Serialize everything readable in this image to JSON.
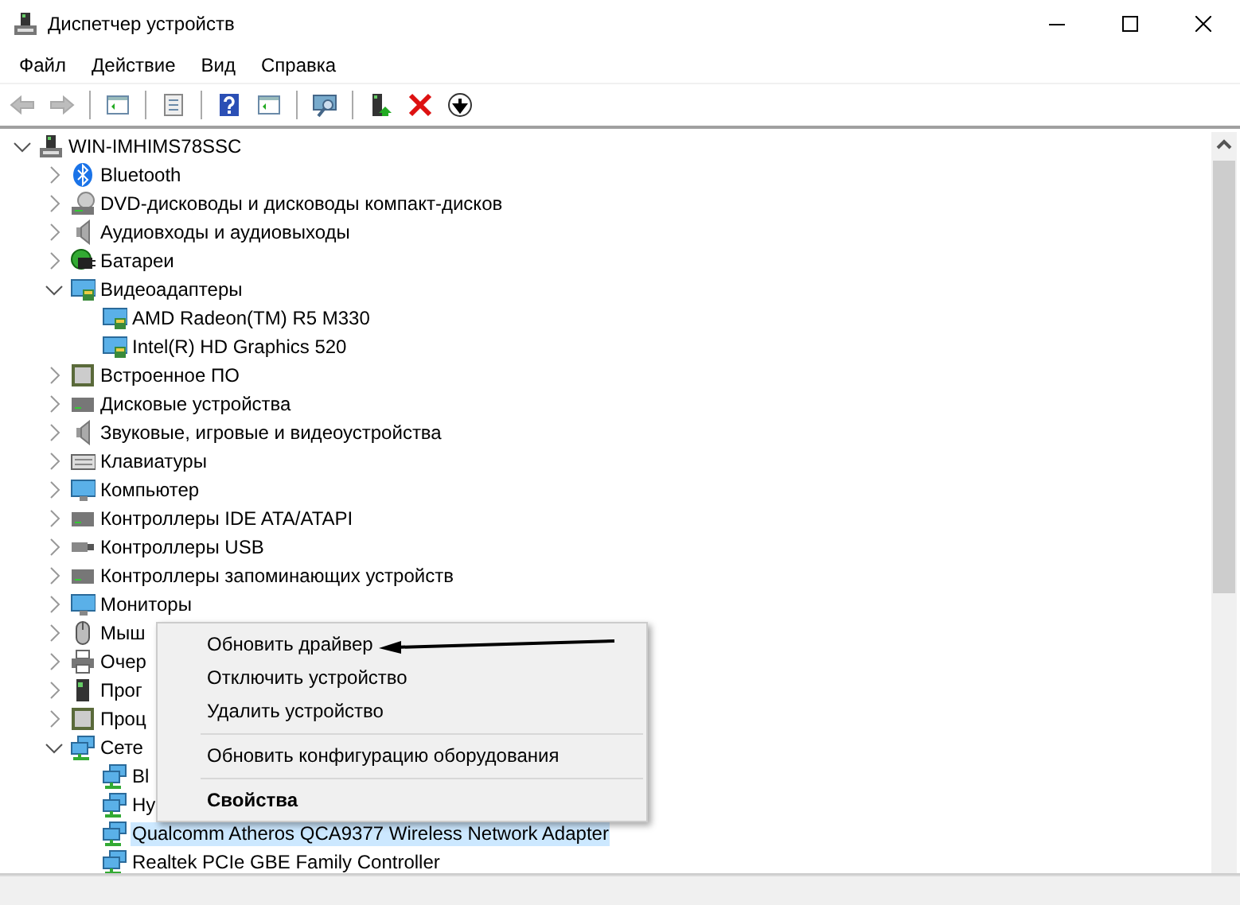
{
  "window": {
    "title": "Диспетчер устройств"
  },
  "menu_bar": [
    {
      "label": "Файл"
    },
    {
      "label": "Действие"
    },
    {
      "label": "Вид"
    },
    {
      "label": "Справка"
    }
  ],
  "toolbar": [
    {
      "kind": "back",
      "disabled": true
    },
    {
      "kind": "forward",
      "disabled": true
    },
    {
      "kind": "separator"
    },
    {
      "kind": "pane"
    },
    {
      "kind": "separator"
    },
    {
      "kind": "properties"
    },
    {
      "kind": "separator"
    },
    {
      "kind": "help"
    },
    {
      "kind": "pane"
    },
    {
      "kind": "separator"
    },
    {
      "kind": "scan"
    },
    {
      "kind": "separator"
    },
    {
      "kind": "update"
    },
    {
      "kind": "remove"
    },
    {
      "kind": "download"
    }
  ],
  "tree": [
    {
      "label": "WIN-IMHIMS78SSC",
      "kind": "computer",
      "expanded": true,
      "selected": false,
      "children": [
        {
          "label": "Bluetooth",
          "kind": "bluetooth",
          "expanded": false,
          "selected": false
        },
        {
          "label": "DVD-дисководы и дисководы компакт-дисков",
          "kind": "disc",
          "expanded": false,
          "selected": false
        },
        {
          "label": "Аудиовходы и аудиовыходы",
          "kind": "speaker",
          "expanded": false,
          "selected": false
        },
        {
          "label": "Батареи",
          "kind": "battery",
          "expanded": false,
          "selected": false
        },
        {
          "label": "Видеоадаптеры",
          "kind": "display",
          "expanded": true,
          "selected": false,
          "children": [
            {
              "label": "AMD Radeon(TM) R5 M330",
              "kind": "display",
              "selected": false
            },
            {
              "label": "Intel(R) HD Graphics 520",
              "kind": "display",
              "selected": false
            }
          ]
        },
        {
          "label": "Встроенное ПО",
          "kind": "chip",
          "expanded": false,
          "selected": false
        },
        {
          "label": "Дисковые устройства",
          "kind": "drive",
          "expanded": false,
          "selected": false
        },
        {
          "label": "Звуковые, игровые и видеоустройства",
          "kind": "speaker",
          "expanded": false,
          "selected": false
        },
        {
          "label": "Клавиатуры",
          "kind": "keyboard",
          "expanded": false,
          "selected": false
        },
        {
          "label": "Компьютер",
          "kind": "monitor",
          "expanded": false,
          "selected": false
        },
        {
          "label": "Контроллеры IDE ATA/ATAPI",
          "kind": "drive",
          "expanded": false,
          "selected": false
        },
        {
          "label": "Контроллеры USB",
          "kind": "usb",
          "expanded": false,
          "selected": false
        },
        {
          "label": "Контроллеры запоминающих устройств",
          "kind": "drive",
          "expanded": false,
          "selected": false
        },
        {
          "label": "Мониторы",
          "kind": "monitor",
          "expanded": false,
          "selected": false
        },
        {
          "label": "Мыш",
          "kind": "mouse",
          "expanded": false,
          "selected": false
        },
        {
          "label": "Очер",
          "kind": "printer",
          "expanded": false,
          "selected": false
        },
        {
          "label": "Прог",
          "kind": "tower",
          "expanded": false,
          "selected": false
        },
        {
          "label": "Проц",
          "kind": "chip",
          "expanded": false,
          "selected": false
        },
        {
          "label": "Сете",
          "kind": "network",
          "expanded": true,
          "selected": false,
          "children": [
            {
              "label": "Bl",
              "kind": "network",
              "selected": false
            },
            {
              "label": "Hy",
              "kind": "network",
              "selected": false
            },
            {
              "label": "Qualcomm Atheros QCA9377 Wireless Network Adapter",
              "kind": "network",
              "selected": true
            },
            {
              "label": "Realtek PCIe GBE Family Controller",
              "kind": "network",
              "selected": false
            }
          ]
        }
      ]
    }
  ],
  "context_menu": [
    {
      "kind": "item",
      "label": "Обновить драйвер",
      "default": false
    },
    {
      "kind": "item",
      "label": "Отключить устройство",
      "default": false
    },
    {
      "kind": "item",
      "label": "Удалить устройство",
      "default": false
    },
    {
      "kind": "separator"
    },
    {
      "kind": "item",
      "label": "Обновить конфигурацию оборудования",
      "default": false
    },
    {
      "kind": "separator"
    },
    {
      "kind": "item",
      "label": "Свойства",
      "default": true
    }
  ]
}
